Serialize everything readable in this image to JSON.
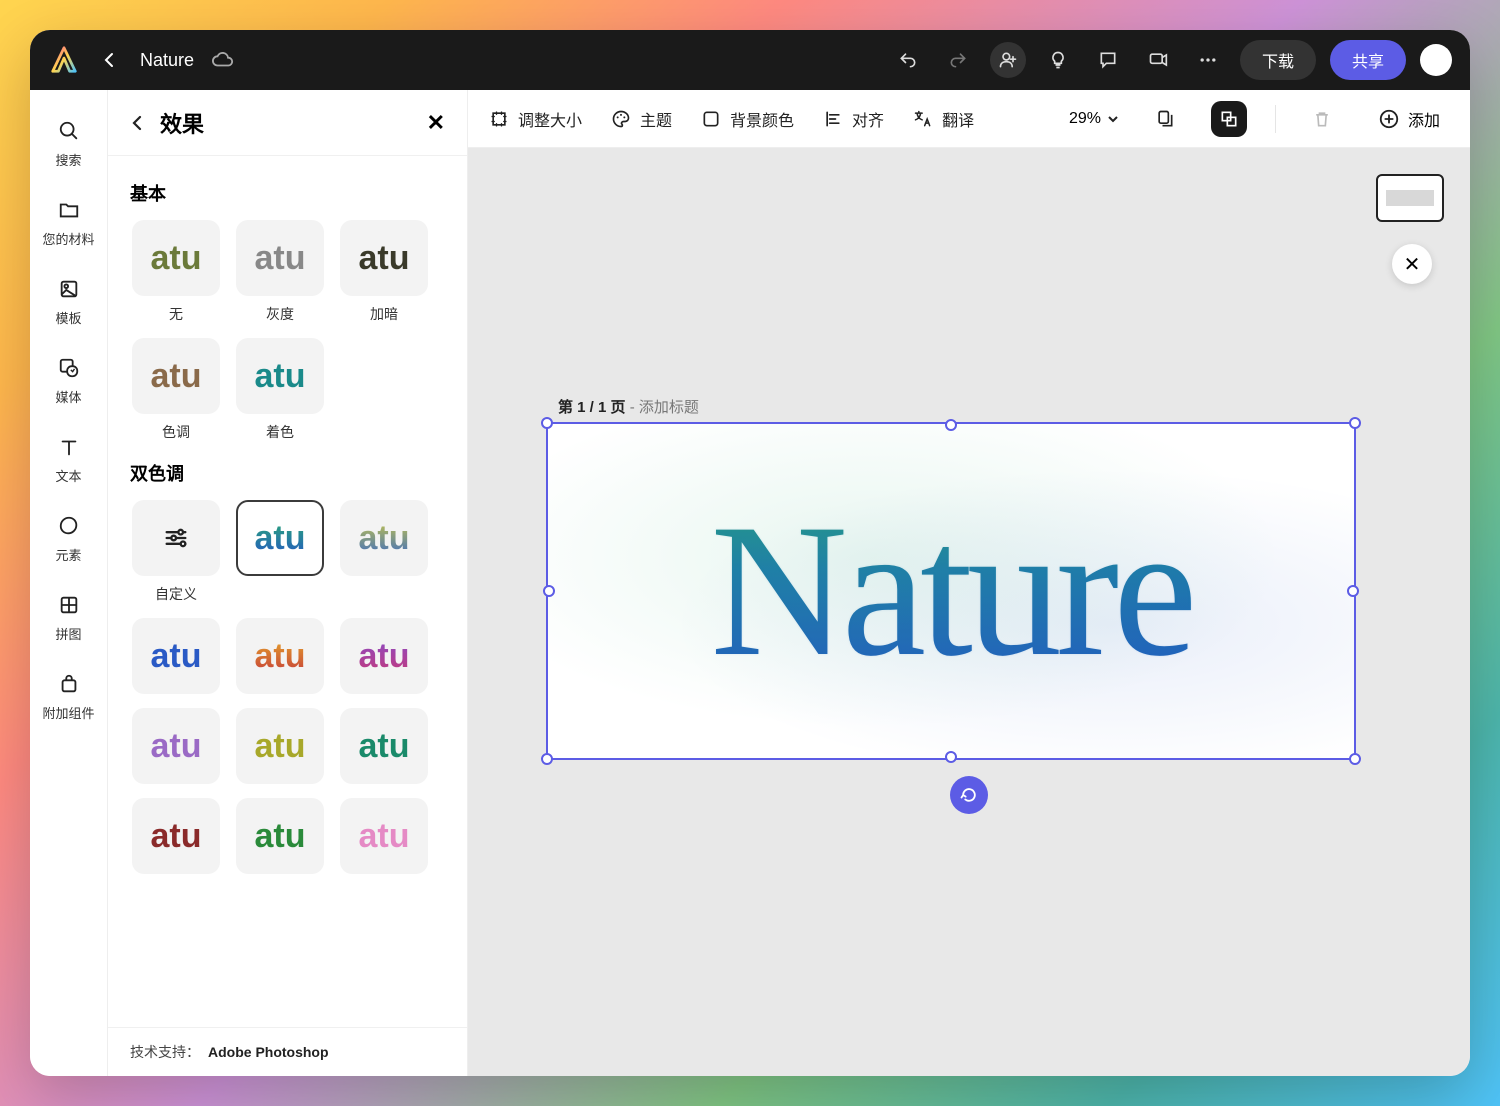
{
  "topbar": {
    "doc_title": "Nature",
    "download_label": "下载",
    "share_label": "共享"
  },
  "rail": {
    "search": "搜索",
    "your_stuff": "您的材料",
    "templates": "模板",
    "media": "媒体",
    "text": "文本",
    "elements": "元素",
    "grids": "拼图",
    "addons": "附加组件"
  },
  "effects_panel": {
    "title": "效果",
    "section_basic": "基本",
    "section_duotone": "双色调",
    "basic": {
      "none": "无",
      "grayscale": "灰度",
      "darken": "加暗",
      "hue": "色调",
      "tint": "着色"
    },
    "duotone": {
      "custom": "自定义"
    },
    "thumb_text": "atu",
    "footer_prefix": "技术支持：",
    "footer_brand": "Adobe Photoshop"
  },
  "canvas_toolbar": {
    "resize": "调整大小",
    "theme": "主题",
    "bgcolor": "背景颜色",
    "align": "对齐",
    "translate": "翻译",
    "zoom": "29%",
    "add": "添加"
  },
  "canvas": {
    "page_label_bold": "第 1 / 1 页",
    "page_label_muted": " - 添加标题",
    "artwork_text": "Nature"
  }
}
